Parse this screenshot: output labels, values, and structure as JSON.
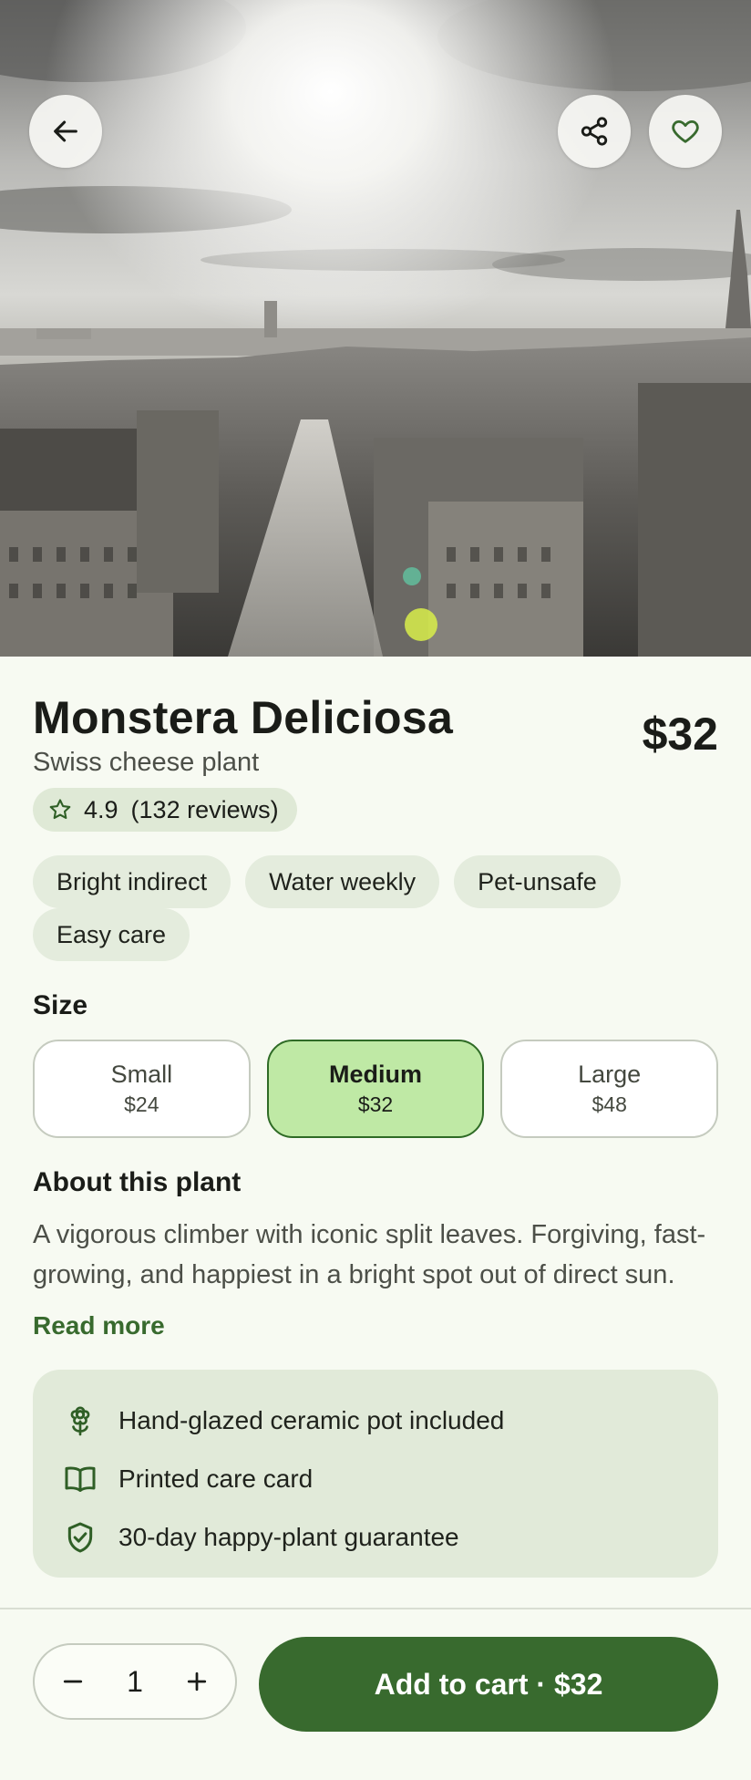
{
  "hero": {
    "image_alt": "city-skyline-photo",
    "back_icon": "arrow-left-icon",
    "share_icon": "share-icon",
    "favorite_icon": "heart-icon"
  },
  "product": {
    "title": "Monstera Deliciosa",
    "subtitle": "Swiss cheese plant",
    "price": "$32",
    "rating": "4.9",
    "reviews": "(132 reviews)"
  },
  "tags": [
    "Bright indirect",
    "Water weekly",
    "Pet-unsafe",
    "Easy care"
  ],
  "size": {
    "label": "Size",
    "options": [
      {
        "name": "Small",
        "price": "$24",
        "selected": false
      },
      {
        "name": "Medium",
        "price": "$32",
        "selected": true
      },
      {
        "name": "Large",
        "price": "$48",
        "selected": false
      }
    ]
  },
  "about": {
    "title": "About this plant",
    "text": "A vigorous climber with iconic split leaves. Forgiving, fast-growing, and happiest in a bright spot out of direct sun.",
    "read_more": "Read more"
  },
  "perks": [
    {
      "icon": "flower-icon",
      "text": "Hand-glazed ceramic pot included"
    },
    {
      "icon": "book-icon",
      "text": "Printed care card"
    },
    {
      "icon": "shield-check-icon",
      "text": "30-day happy-plant guarantee"
    }
  ],
  "bottom_bar": {
    "quantity": "1",
    "cart_label": "Add to cart · $32"
  },
  "colors": {
    "primary": "#386a2e",
    "selected_size_bg": "#bfe9a5",
    "chip_bg": "#e4ecdd",
    "background": "#f7faf2"
  }
}
